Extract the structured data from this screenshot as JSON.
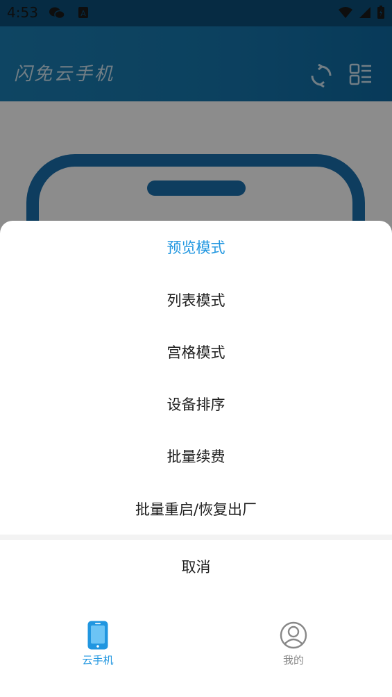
{
  "status_bar": {
    "time": "4:53"
  },
  "header": {
    "title": "闪免云手机",
    "refresh_icon": "refresh-icon",
    "layout_icon": "list-layout-icon"
  },
  "sheet": {
    "items": [
      {
        "label": "预览模式",
        "active": true
      },
      {
        "label": "列表模式",
        "active": false
      },
      {
        "label": "宫格模式",
        "active": false
      },
      {
        "label": "设备排序",
        "active": false
      },
      {
        "label": "批量续费",
        "active": false
      },
      {
        "label": "批量重启/恢复出厂",
        "active": false
      }
    ],
    "cancel_label": "取消"
  },
  "bottom_nav": {
    "tabs": [
      {
        "label": "云手机",
        "icon": "phone-icon",
        "active": true
      },
      {
        "label": "我的",
        "icon": "profile-icon",
        "active": false
      }
    ]
  },
  "colors": {
    "accent": "#2096e0",
    "header_bg": "#1676ad",
    "overlay": "rgba(0,0,0,0.45)"
  }
}
